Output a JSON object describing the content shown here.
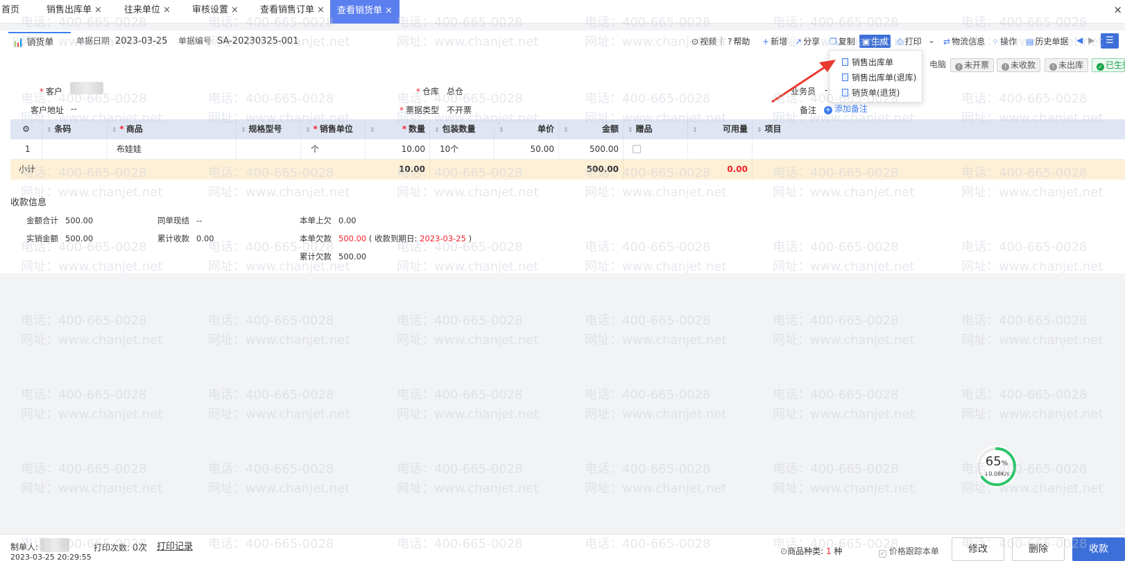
{
  "top_tabs": [
    {
      "label": "首页",
      "closable": false
    },
    {
      "label": "销售出库单",
      "closable": true
    },
    {
      "label": "往来单位",
      "closable": true
    },
    {
      "label": "审核设置",
      "closable": true
    },
    {
      "label": "查看销售订单",
      "closable": true
    },
    {
      "label": "查看销货单",
      "closable": true,
      "active": true
    }
  ],
  "close_glyph": "×",
  "doc_tab": {
    "label": "销货单",
    "icon": "chart-doc-icon"
  },
  "header": {
    "date_label": "单据日期",
    "date": "2023-03-25",
    "number_label": "单据编号",
    "number": "SA-20230325-001"
  },
  "toolbar": {
    "video": "视频",
    "separator": "|",
    "help": "帮助",
    "new": "新增",
    "share": "分享",
    "copy": "复制",
    "generate": "生成",
    "print": "打印",
    "logistics": "物流信息",
    "operate": "操作",
    "history": "历史单据"
  },
  "dropdown": [
    "销售出库单",
    "销售出库单(退库)",
    "销货单(退货)"
  ],
  "badges": {
    "computer": "电脑",
    "not_invoiced": "未开票",
    "not_received": "未收款",
    "not_outbound": "未出库",
    "effective": "已生效"
  },
  "form": {
    "customer_label": "客户",
    "address_label": "客户地址",
    "address_value": "--",
    "warehouse_label": "仓库",
    "warehouse_value": "总仓",
    "invoice_label": "票据类型",
    "invoice_value": "不开票",
    "salesman_label": "业务员",
    "salesman_value": "-",
    "note_label": "备注",
    "add_note": "添加备注"
  },
  "table": {
    "columns": [
      "条码",
      "商品",
      "规格型号",
      "销售单位",
      "数量",
      "包装数量",
      "单价",
      "金额",
      "赠品",
      "可用量",
      "项目"
    ],
    "rows": [
      {
        "no": "1",
        "barcode": "",
        "product": "布娃娃",
        "spec": "",
        "unit": "个",
        "qty": "10.00",
        "pack": "10个",
        "price": "50.00",
        "amount": "500.00",
        "gift": false,
        "avail": "",
        "project": ""
      }
    ],
    "subtotal": {
      "label": "小计",
      "qty": "10.00",
      "amount": "500.00",
      "avail": "0.00"
    }
  },
  "payment": {
    "title": "收款信息",
    "total_label": "金额合计",
    "total": "500.00",
    "cash_label": "同单现结",
    "cash": "--",
    "prev_owe_label": "本单上欠",
    "prev_owe": "0.00",
    "actual_label": "实销金额",
    "actual": "500.00",
    "received_label": "累计收款",
    "received": "0.00",
    "owe_label": "本单欠款",
    "owe": "500.00",
    "due_prefix": "( 收款到期日:",
    "due_date": "2023-03-25",
    "due_suffix": ")",
    "total_owe_label": "累计欠款",
    "total_owe": "500.00"
  },
  "watermark": {
    "phone": "电话：400-665-0028",
    "site": "网址：www.chanjet.net"
  },
  "progress": {
    "percent": 65,
    "speed": "0.08K/s"
  },
  "footer": {
    "maker_label": "制单人:",
    "print_count_label": "打印次数:",
    "print_count": "0次",
    "print_record": "打印记录",
    "timestamp": "2023-03-25 20:29:55",
    "kinds_label": "商品种类:",
    "kinds_count": "1",
    "kinds_unit": "种",
    "price_track": "价格跟踪本单",
    "modify": "修改",
    "delete": "删除",
    "receive": "收款"
  }
}
